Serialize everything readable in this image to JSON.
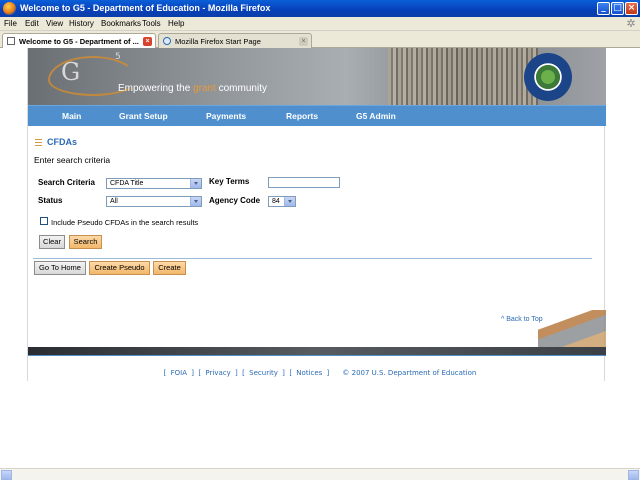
{
  "window": {
    "title": "Welcome to G5 - Department of Education - Mozilla Firefox",
    "minimize": "_",
    "maximize": "□",
    "close": "×"
  },
  "menubar": {
    "items": [
      "File",
      "Edit",
      "View",
      "History",
      "Bookmarks",
      "Tools",
      "Help"
    ]
  },
  "tabs": [
    {
      "label": "Welcome to G5 - Department of ...",
      "active": true
    },
    {
      "label": "Mozilla Firefox Start Page",
      "active": false
    }
  ],
  "banner": {
    "logo_main": "G",
    "logo_sup": "5",
    "tagline_before": "Empowering the ",
    "tagline_accent": "grant",
    "tagline_after": " community"
  },
  "nav": {
    "items": [
      "Main",
      "Grant Setup",
      "Payments",
      "Reports",
      "G5 Admin"
    ]
  },
  "section": {
    "title": "CFDAs",
    "subtitle": "Enter search criteria"
  },
  "form": {
    "search_criteria_label": "Search Criteria",
    "search_criteria_value": "CFDA Title",
    "key_terms_label": "Key Terms",
    "key_terms_value": "",
    "status_label": "Status",
    "status_value": "All",
    "agency_code_label": "Agency Code",
    "agency_code_value": "84",
    "pseudo_checkbox_label": "Include Pseudo CFDAs in the search results",
    "clear_button": "Clear",
    "search_button": "Search"
  },
  "actions": {
    "go_home": "Go To Home",
    "create_pseudo": "Create Pseudo",
    "create": "Create"
  },
  "back_to_top": "^ Back to Top",
  "footer": {
    "foia": "FOIA",
    "privacy": "Privacy",
    "security": "Security",
    "notices": "Notices",
    "copyright": "© 2007 U.S. Department of Education"
  },
  "colors": {
    "nav_blue": "#4f8fce",
    "link_blue": "#2a6ab5",
    "accent_orange": "#e89a3a",
    "button_orange": "#f3b76a"
  }
}
